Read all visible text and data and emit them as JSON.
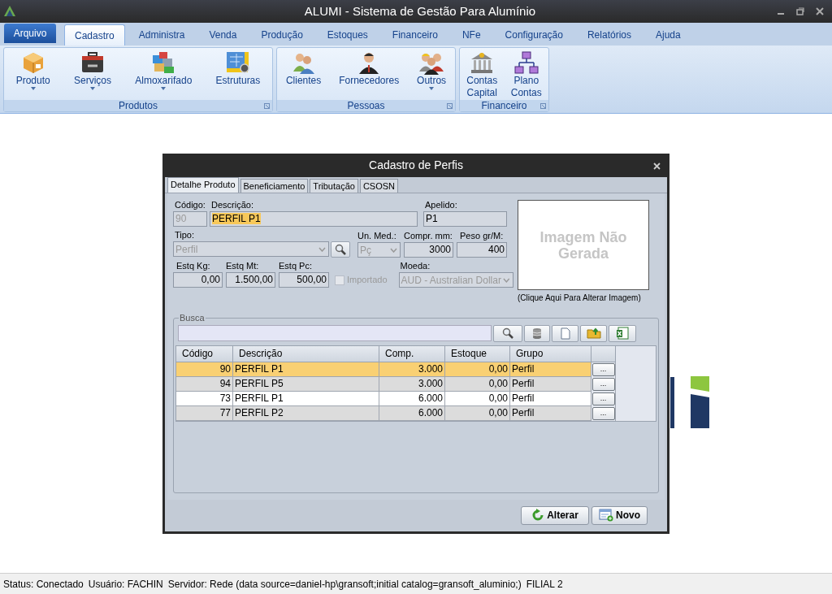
{
  "window": {
    "title": "ALUMI - Sistema de Gestão Para Alumínio"
  },
  "menu_tabs": [
    {
      "label": "Arquivo",
      "kind": "app",
      "selected": false
    },
    {
      "label": "Cadastro",
      "kind": "tab",
      "selected": true
    },
    {
      "label": "Administra",
      "kind": "tab",
      "selected": false
    },
    {
      "label": "Venda",
      "kind": "tab",
      "selected": false
    },
    {
      "label": "Produção",
      "kind": "tab",
      "selected": false
    },
    {
      "label": "Estoques",
      "kind": "tab",
      "selected": false
    },
    {
      "label": "Financeiro",
      "kind": "tab",
      "selected": false
    },
    {
      "label": "NFe",
      "kind": "tab",
      "selected": false
    },
    {
      "label": "Configuração",
      "kind": "tab",
      "selected": false
    },
    {
      "label": "Relatórios",
      "kind": "tab",
      "selected": false
    },
    {
      "label": "Ajuda",
      "kind": "tab",
      "selected": false
    }
  ],
  "ribbon_groups": [
    {
      "label": "Produtos",
      "buttons": [
        {
          "label": "Produto",
          "dropdown": true
        },
        {
          "label": "Serviços",
          "dropdown": true
        },
        {
          "label": "Almoxarifado",
          "dropdown": true
        },
        {
          "label": "Estruturas",
          "dropdown": false
        }
      ]
    },
    {
      "label": "Pessoas",
      "buttons": [
        {
          "label": "Clientes",
          "dropdown": false
        },
        {
          "label": "Fornecedores",
          "dropdown": false
        },
        {
          "label": "Outros",
          "dropdown": true
        }
      ]
    },
    {
      "label": "Financeiro",
      "buttons": [
        {
          "label": "Contas Capital",
          "dropdown": false
        },
        {
          "label": "Plano Contas",
          "dropdown": false
        }
      ]
    }
  ],
  "dialog": {
    "title": "Cadastro de Perfis",
    "tabs": [
      {
        "label": "Detalhe Produto",
        "selected": true
      },
      {
        "label": "Beneficiamento",
        "selected": false
      },
      {
        "label": "Tributação",
        "selected": false
      },
      {
        "label": "CSOSN",
        "selected": false
      }
    ],
    "fields": {
      "codigo": {
        "label": "Código:",
        "value": "90",
        "disabled": true
      },
      "descricao": {
        "label": "Descrição:",
        "value": "PERFIL P1",
        "highlighted": true
      },
      "apelido": {
        "label": "Apelido:",
        "value": "P1"
      },
      "tipo": {
        "label": "Tipo:",
        "value": "Perfil",
        "disabled": true
      },
      "un_med": {
        "label": "Un. Med.:",
        "value": "Pç",
        "disabled": true
      },
      "compr": {
        "label": "Compr. mm:",
        "value": "3000"
      },
      "peso": {
        "label": "Peso gr/M:",
        "value": "400"
      },
      "estq_kg": {
        "label": "Estq Kg:",
        "value": "0,00"
      },
      "estq_mt": {
        "label": "Estq Mt:",
        "value": "1.500,00"
      },
      "estq_pc": {
        "label": "Estq Pc:",
        "value": "500,00"
      },
      "importado": {
        "label": "Importado",
        "checked": false,
        "disabled": true
      },
      "moeda": {
        "label": "Moeda:",
        "value": "AUD - Australian Dollar",
        "disabled": true
      }
    },
    "image": {
      "placeholder": "Imagem Não Gerada",
      "caption": "(Clique Aqui Para Alterar Imagem)"
    },
    "search": {
      "label": "Busca"
    },
    "table": {
      "columns": [
        "Código",
        "Descrição",
        "Comp.",
        "Estoque",
        "Grupo"
      ],
      "rows": [
        {
          "cells": [
            "90",
            "PERFIL P1",
            "3.000",
            "0,00",
            "Perfil"
          ],
          "button": "...",
          "selected": true
        },
        {
          "cells": [
            "94",
            "PERFIL P5",
            "3.000",
            "0,00",
            "Perfil"
          ],
          "button": "...",
          "selected": false
        },
        {
          "cells": [
            "73",
            "PERFIL P1",
            "6.000",
            "0,00",
            "Perfil"
          ],
          "button": "...",
          "selected": false
        },
        {
          "cells": [
            "77",
            "PERFIL P2",
            "6.000",
            "0,00",
            "Perfil"
          ],
          "button": "...",
          "selected": false
        }
      ]
    },
    "buttons": [
      "Alterar",
      "Novo"
    ]
  },
  "status_bar": [
    "Status: Conectado",
    "Usuário: FACHIN",
    "Servidor: Rede (data source=daniel-hp\\gransoft;initial catalog=gransoft_aluminio;)",
    "FILIAL 2"
  ]
}
